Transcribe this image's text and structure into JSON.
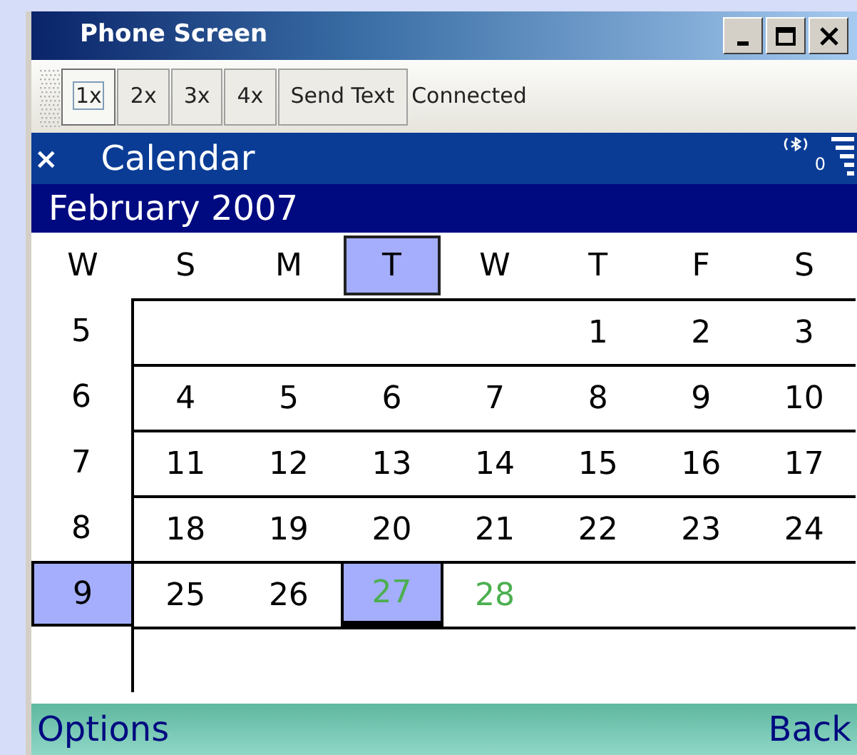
{
  "window": {
    "title": "Phone Screen"
  },
  "toolbar": {
    "buttons": [
      {
        "label": "1x",
        "selected": true
      },
      {
        "label": "2x",
        "selected": false
      },
      {
        "label": "3x",
        "selected": false
      },
      {
        "label": "4x",
        "selected": false
      },
      {
        "label": "Send Text",
        "selected": false
      }
    ],
    "status": "Connected"
  },
  "app_header": {
    "close_glyph": "×",
    "title": "Calendar",
    "indicator_text": "0"
  },
  "month": "February 2007",
  "week_header": {
    "label": "W"
  },
  "weekdays": [
    {
      "label": "S",
      "selected": false
    },
    {
      "label": "M",
      "selected": false
    },
    {
      "label": "T",
      "selected": true
    },
    {
      "label": "W",
      "selected": false
    },
    {
      "label": "T",
      "selected": false
    },
    {
      "label": "F",
      "selected": false
    },
    {
      "label": "S",
      "selected": false
    }
  ],
  "weeks": [
    {
      "number": "5",
      "selected": false,
      "days": [
        {
          "kind": "empty"
        },
        {
          "kind": "empty"
        },
        {
          "kind": "empty"
        },
        {
          "kind": "empty"
        },
        {
          "label": "1",
          "selected": false,
          "color": "#000000"
        },
        {
          "label": "2",
          "selected": false,
          "color": "#000000"
        },
        {
          "label": "3",
          "selected": false,
          "color": "#000000"
        }
      ]
    },
    {
      "number": "6",
      "selected": false,
      "days": [
        {
          "label": "4",
          "selected": false,
          "color": "#000000"
        },
        {
          "label": "5",
          "selected": false,
          "color": "#000000"
        },
        {
          "label": "6",
          "selected": false,
          "color": "#000000"
        },
        {
          "label": "7",
          "selected": false,
          "color": "#000000"
        },
        {
          "label": "8",
          "selected": false,
          "color": "#000000"
        },
        {
          "label": "9",
          "selected": false,
          "color": "#000000"
        },
        {
          "label": "10",
          "selected": false,
          "color": "#000000"
        }
      ]
    },
    {
      "number": "7",
      "selected": false,
      "days": [
        {
          "label": "11",
          "selected": false,
          "color": "#000000"
        },
        {
          "label": "12",
          "selected": false,
          "color": "#000000"
        },
        {
          "label": "13",
          "selected": false,
          "color": "#000000"
        },
        {
          "label": "14",
          "selected": false,
          "color": "#000000"
        },
        {
          "label": "15",
          "selected": false,
          "color": "#000000"
        },
        {
          "label": "16",
          "selected": false,
          "color": "#000000"
        },
        {
          "label": "17",
          "selected": false,
          "color": "#000000"
        }
      ]
    },
    {
      "number": "8",
      "selected": false,
      "days": [
        {
          "label": "18",
          "selected": false,
          "color": "#000000"
        },
        {
          "label": "19",
          "selected": false,
          "color": "#000000"
        },
        {
          "label": "20",
          "selected": false,
          "color": "#000000"
        },
        {
          "label": "21",
          "selected": false,
          "color": "#000000"
        },
        {
          "label": "22",
          "selected": false,
          "color": "#000000"
        },
        {
          "label": "23",
          "selected": false,
          "color": "#000000"
        },
        {
          "label": "24",
          "selected": false,
          "color": "#000000"
        }
      ]
    },
    {
      "number": "9",
      "selected": true,
      "days": [
        {
          "label": "25",
          "selected": false,
          "color": "#000000"
        },
        {
          "label": "26",
          "selected": false,
          "color": "#000000"
        },
        {
          "label": "27",
          "selected": true,
          "color": "#4caf50"
        },
        {
          "label": "28",
          "selected": false,
          "color": "#4caf50"
        },
        {
          "kind": "empty"
        },
        {
          "kind": "empty"
        },
        {
          "kind": "empty"
        }
      ]
    }
  ],
  "softkeys": {
    "left": "Options",
    "right": "Back"
  }
}
